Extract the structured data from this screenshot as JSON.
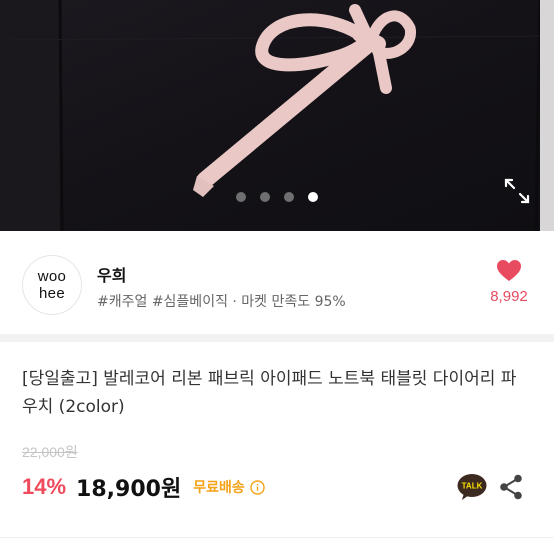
{
  "gallery": {
    "image_alt": "black fabric pouch with pink ribbon bow",
    "slide_count": 4,
    "active_slide": 4,
    "colors": {
      "background": "#161419",
      "ribbon": "#e9c8c6",
      "dot_inactive": "#6f6f72",
      "dot_active": "#ffffff"
    },
    "expand_icon": "expand-icon"
  },
  "shop": {
    "logo_line1": "woo",
    "logo_line2": "hee",
    "name": "우희",
    "tags": "#캐주얼 #심플베이직 · 마켓 만족도 95%",
    "like_icon": "heart-icon",
    "like_count": "8,992",
    "like_color": "#e84a5f"
  },
  "product": {
    "title": "[당일출고] 발레코어 리본 패브릭 아이패드 노트북 태블릿 다이어리 파우치 (2color)",
    "original_price": "22,000원",
    "discount": "14%",
    "price": "18,900원",
    "shipping": "무료배송",
    "shipping_info_icon": "info-icon",
    "talk_label": "TALK",
    "share_icon": "share-icon",
    "colors": {
      "discount": "#ef4b5c",
      "shipping": "#f6a318",
      "talk_bg": "#3c2a21"
    }
  }
}
